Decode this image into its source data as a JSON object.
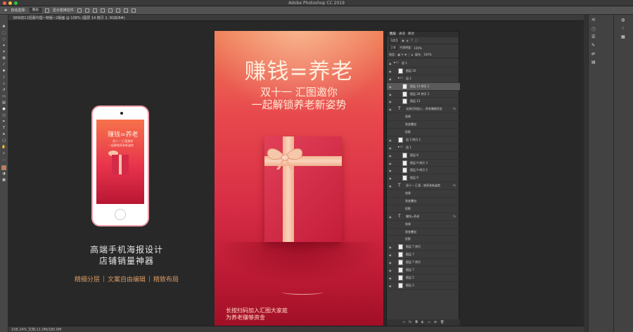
{
  "app": {
    "title": "Adobe Photoshop CC 2019"
  },
  "options_bar": {
    "auto_select": "自动选择:",
    "auto_select_value": "图层",
    "transform": "显示变换控件"
  },
  "document": {
    "tab_label": "38W双11招募代理~特版~2版面 @ 108% (图层 14 拷贝 2, RGB/8#)",
    "status": "108.24%   文档:11.0M/180.0M"
  },
  "tools": {
    "icons": [
      "move-icon",
      "marquee-icon",
      "lasso-icon",
      "magic-wand-icon",
      "crop-icon",
      "frame-icon",
      "eyedropper-icon",
      "heal-icon",
      "brush-icon",
      "stamp-icon",
      "history-brush-icon",
      "eraser-icon",
      "gradient-icon",
      "blur-icon",
      "dodge-icon",
      "pen-icon",
      "type-icon",
      "path-select-icon",
      "shape-icon",
      "hand-icon",
      "zoom-icon",
      "more-icon"
    ]
  },
  "promo": {
    "phone": {
      "title": "赚钱=养老",
      "line1": "双十一 汇图邀你",
      "line2": "一起解锁养老新姿势"
    },
    "caption1": "高端手机海报设计",
    "caption2": "店铺销量神器",
    "features": [
      "精细分层",
      "文案自由编辑",
      "精致布局"
    ]
  },
  "poster": {
    "headline": "赚钱=养老",
    "sub1": "双十一 汇图邀你",
    "sub2": "一起解锁养老新姿势",
    "footer1": "长按扫码加入汇图大家庭",
    "footer2": "为养老赚够资金"
  },
  "layers_panel": {
    "tabs": [
      "图层",
      "通道",
      "路径"
    ],
    "filter": "Q类型",
    "blend_mode": "正常",
    "opacity_label": "不透明度:",
    "opacity": "100%",
    "lock_label": "锁定:",
    "fill_label": "填充:",
    "fill": "100%",
    "layers": [
      {
        "name": "组 1",
        "type": "group",
        "indent": 0
      },
      {
        "name": "图层 16",
        "type": "pixel",
        "indent": 1
      },
      {
        "name": "组 2",
        "type": "group",
        "indent": 1
      },
      {
        "name": "图层 14 拷贝 2",
        "type": "pixel",
        "indent": 2,
        "selected": true
      },
      {
        "name": "图层 28 拷贝 2",
        "type": "pixel",
        "indent": 2
      },
      {
        "name": "图层 13",
        "type": "pixel",
        "indent": 2
      },
      {
        "name": "长按扫码加入...养老赚够资金",
        "type": "text",
        "indent": 1,
        "fx": true
      },
      {
        "name": "效果",
        "type": "effect",
        "indent": 2
      },
      {
        "name": "渐变叠加",
        "type": "effect",
        "indent": 2
      },
      {
        "name": "投影",
        "type": "effect",
        "indent": 2
      },
      {
        "name": "组 3 拷贝 2",
        "type": "pixel",
        "indent": 1
      },
      {
        "name": "组 1",
        "type": "group",
        "indent": 1
      },
      {
        "name": "图层 8",
        "type": "pixel",
        "indent": 2
      },
      {
        "name": "图层 9 拷贝 3",
        "type": "pixel",
        "indent": 2
      },
      {
        "name": "图层 9 拷贝 2",
        "type": "pixel",
        "indent": 2
      },
      {
        "name": "图层 9",
        "type": "pixel",
        "indent": 2
      },
      {
        "name": "双十一 汇图...锁养老新姿势",
        "type": "text",
        "indent": 1,
        "fx": true
      },
      {
        "name": "效果",
        "type": "effect",
        "indent": 2
      },
      {
        "name": "渐变叠加",
        "type": "effect",
        "indent": 2
      },
      {
        "name": "投影",
        "type": "effect",
        "indent": 2
      },
      {
        "name": "赚钱=养老",
        "type": "text",
        "indent": 1,
        "fx": true
      },
      {
        "name": "效果",
        "type": "effect",
        "indent": 2
      },
      {
        "name": "渐变叠加",
        "type": "effect",
        "indent": 2
      },
      {
        "name": "投影",
        "type": "effect",
        "indent": 2
      },
      {
        "name": "图层 7 拷贝",
        "type": "pixel",
        "indent": 1
      },
      {
        "name": "图层 7",
        "type": "pixel",
        "indent": 1
      },
      {
        "name": "图层 7 拷贝",
        "type": "pixel",
        "indent": 1
      },
      {
        "name": "图层 7",
        "type": "pixel",
        "indent": 1
      },
      {
        "name": "图层 5",
        "type": "pixel",
        "indent": 1
      },
      {
        "name": "图层 2",
        "type": "pixel",
        "indent": 1
      }
    ],
    "bottom_icons": [
      "link-icon",
      "fx-icon",
      "mask-icon",
      "adjustment-icon",
      "folder-icon",
      "new-layer-icon",
      "trash-icon"
    ]
  },
  "colors": {
    "poster_top": "#ef7c55",
    "poster_bottom": "#9f0f26",
    "ribbon": "#f5c4a7",
    "feature_text": "#d89a63",
    "foreground_swatch": "#c97a4e"
  }
}
